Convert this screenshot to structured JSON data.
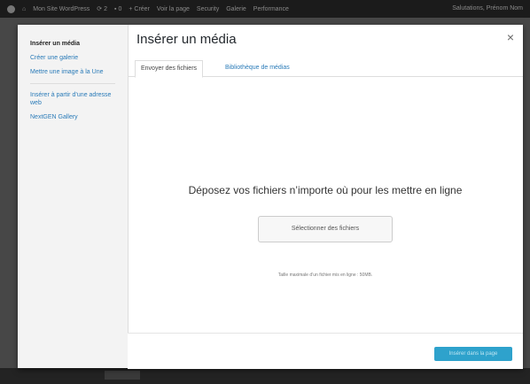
{
  "admin_bar": {
    "site": "Mon Site WordPress",
    "updates": "2",
    "comments": "0",
    "new": "Créer",
    "view_page": "Voir la page",
    "items": [
      "Security",
      "Galerie",
      "Performance"
    ],
    "account": "Salutations, Prénom Nom"
  },
  "media_modal": {
    "menu": {
      "items": [
        {
          "label": "Insérer un média"
        },
        {
          "label": "Créer une galerie"
        },
        {
          "label": "Mettre une image à la Une"
        },
        {
          "label": "Insérer à partir d’une adresse web"
        },
        {
          "label": "NextGEN Gallery"
        }
      ]
    },
    "title": "Insérer un média",
    "close_glyph": "×",
    "tabs": [
      {
        "label": "Envoyer des fichiers",
        "active": true
      },
      {
        "label": "Bibliothèque de médias",
        "active": false
      }
    ],
    "uploader": {
      "instructions": "Déposez vos fichiers n’importe où pour les mettre en ligne",
      "select_button": "Sélectionner des fichiers",
      "max_size": "Taille maximale d’un fichier mis en ligne : 50MB."
    },
    "toolbar": {
      "insert_button": "Insérer dans la page"
    }
  },
  "colors": {
    "link": "#2a7bb8",
    "primary_button": "#2ea2cc",
    "admin_bar": "#1b1b1b",
    "overlay": "#474747"
  }
}
